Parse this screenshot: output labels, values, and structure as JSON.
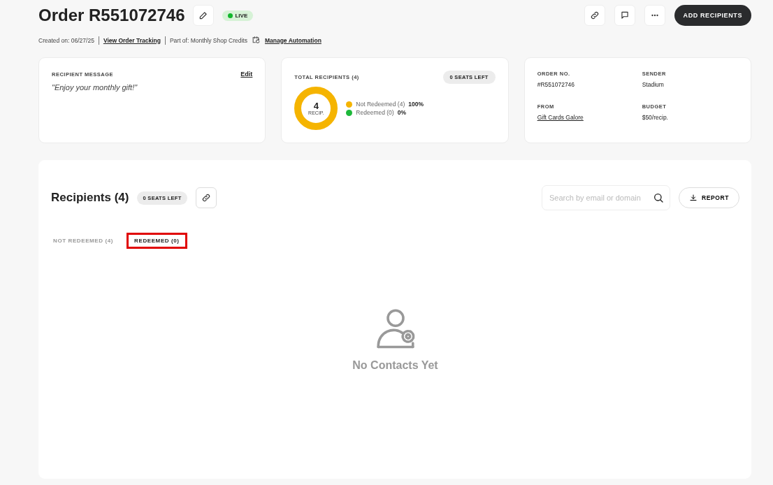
{
  "header": {
    "title": "Order R551072746",
    "status": "LIVE",
    "created": "Created on: 06/27/25",
    "tracking_link": "View Order Tracking",
    "part_of": "Part of: Monthly Shop Credits",
    "automation_link": "Manage Automation",
    "primary_button": "ADD RECIPIENTS"
  },
  "message_card": {
    "label": "RECIPIENT MESSAGE",
    "edit": "Edit",
    "message": "\"Enjoy your monthly gift!\""
  },
  "totals_card": {
    "label": "TOTAL RECIPIENTS (4)",
    "seats": "0 SEATS LEFT",
    "donut_value": "4",
    "donut_unit": "RECIP.",
    "legend": [
      {
        "label": "Not Redeemed (4)",
        "percent": "100%",
        "color": "#f5b400",
        "level": 1
      },
      {
        "label": "Redeemed (0)",
        "percent": "0%",
        "color": "#1db83a",
        "level": 0
      }
    ]
  },
  "details_card": {
    "fields": [
      {
        "label": "ORDER NO.",
        "value": "#R551072746",
        "kind": "text"
      },
      {
        "label": "SENDER",
        "value": "Stadium",
        "kind": "text"
      },
      {
        "label": "FROM",
        "value": "Gift Cards Galore",
        "kind": "link"
      },
      {
        "label": "BUDGET",
        "value": "$50/recip.",
        "kind": "text"
      }
    ]
  },
  "recipients": {
    "title": "Recipients (4)",
    "seats": "0 SEATS LEFT",
    "search": {
      "placeholder": "Search by email or domain"
    },
    "report_button": "REPORT",
    "tabs": [
      {
        "label": "NOT REDEEMED (4)",
        "selected": false,
        "highlighted": false
      },
      {
        "label": "REDEEMED (0)",
        "selected": true,
        "highlighted": true
      }
    ],
    "empty_text": "No Contacts Yet"
  }
}
